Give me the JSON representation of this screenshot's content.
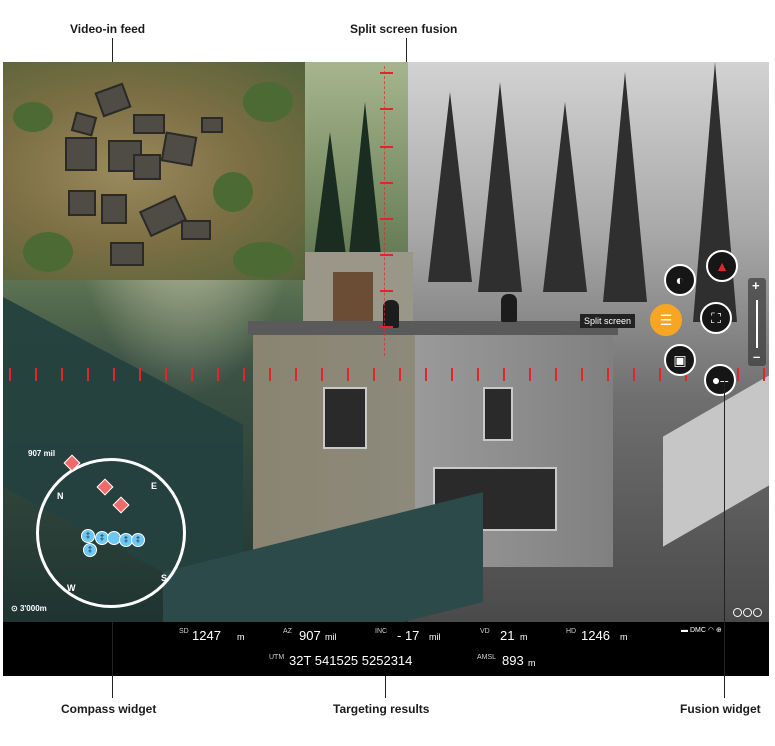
{
  "callouts": {
    "video_in_feed": "Video-in feed",
    "split_screen_fusion": "Split screen fusion",
    "compass_widget": "Compass widget",
    "targeting_results": "Targeting results",
    "fusion_widget": "Fusion widget"
  },
  "compass": {
    "heading_readout": "907 mil",
    "range_readout": "3'000m",
    "cardinal": {
      "north": "N",
      "east": "E",
      "south": "S",
      "west": "W"
    },
    "colors": {
      "hostile": "#ef6a6a",
      "friendly": "#6ec7ef"
    }
  },
  "fusion_widget": {
    "tooltip": "Split screen",
    "buttons": [
      {
        "name": "palette",
        "icon": "palette-icon",
        "active": false
      },
      {
        "name": "threat",
        "icon": "threat-warning-icon",
        "active": false
      },
      {
        "name": "split-screen",
        "icon": "split-screen-icon",
        "active": true
      },
      {
        "name": "fullscreen",
        "icon": "fullscreen-frame-icon",
        "active": false
      },
      {
        "name": "picture-in-picture",
        "icon": "pip-icon",
        "active": false
      },
      {
        "name": "fusion-slider-toggle",
        "icon": "slider-icon",
        "active": false
      }
    ],
    "zoom_plus": "+",
    "zoom_minus": "–",
    "accent": "#f6a623"
  },
  "targeting": {
    "sd": {
      "label": "SD",
      "value": "1247",
      "unit": "m"
    },
    "az": {
      "label": "AZ",
      "value": "907",
      "unit": "mil"
    },
    "inc": {
      "label": "INC",
      "value": "- 17",
      "unit": "mil"
    },
    "vd": {
      "label": "VD",
      "value": "21",
      "unit": "m"
    },
    "hd": {
      "label": "HD",
      "value": "1246",
      "unit": "m"
    },
    "utm": {
      "label": "UTM",
      "value": "32T 541525 5252314"
    },
    "amsl": {
      "label": "AMSL",
      "value": "893",
      "unit": "m"
    },
    "status": {
      "dmc": "DMC"
    }
  },
  "reticle_color": "#e2242b"
}
